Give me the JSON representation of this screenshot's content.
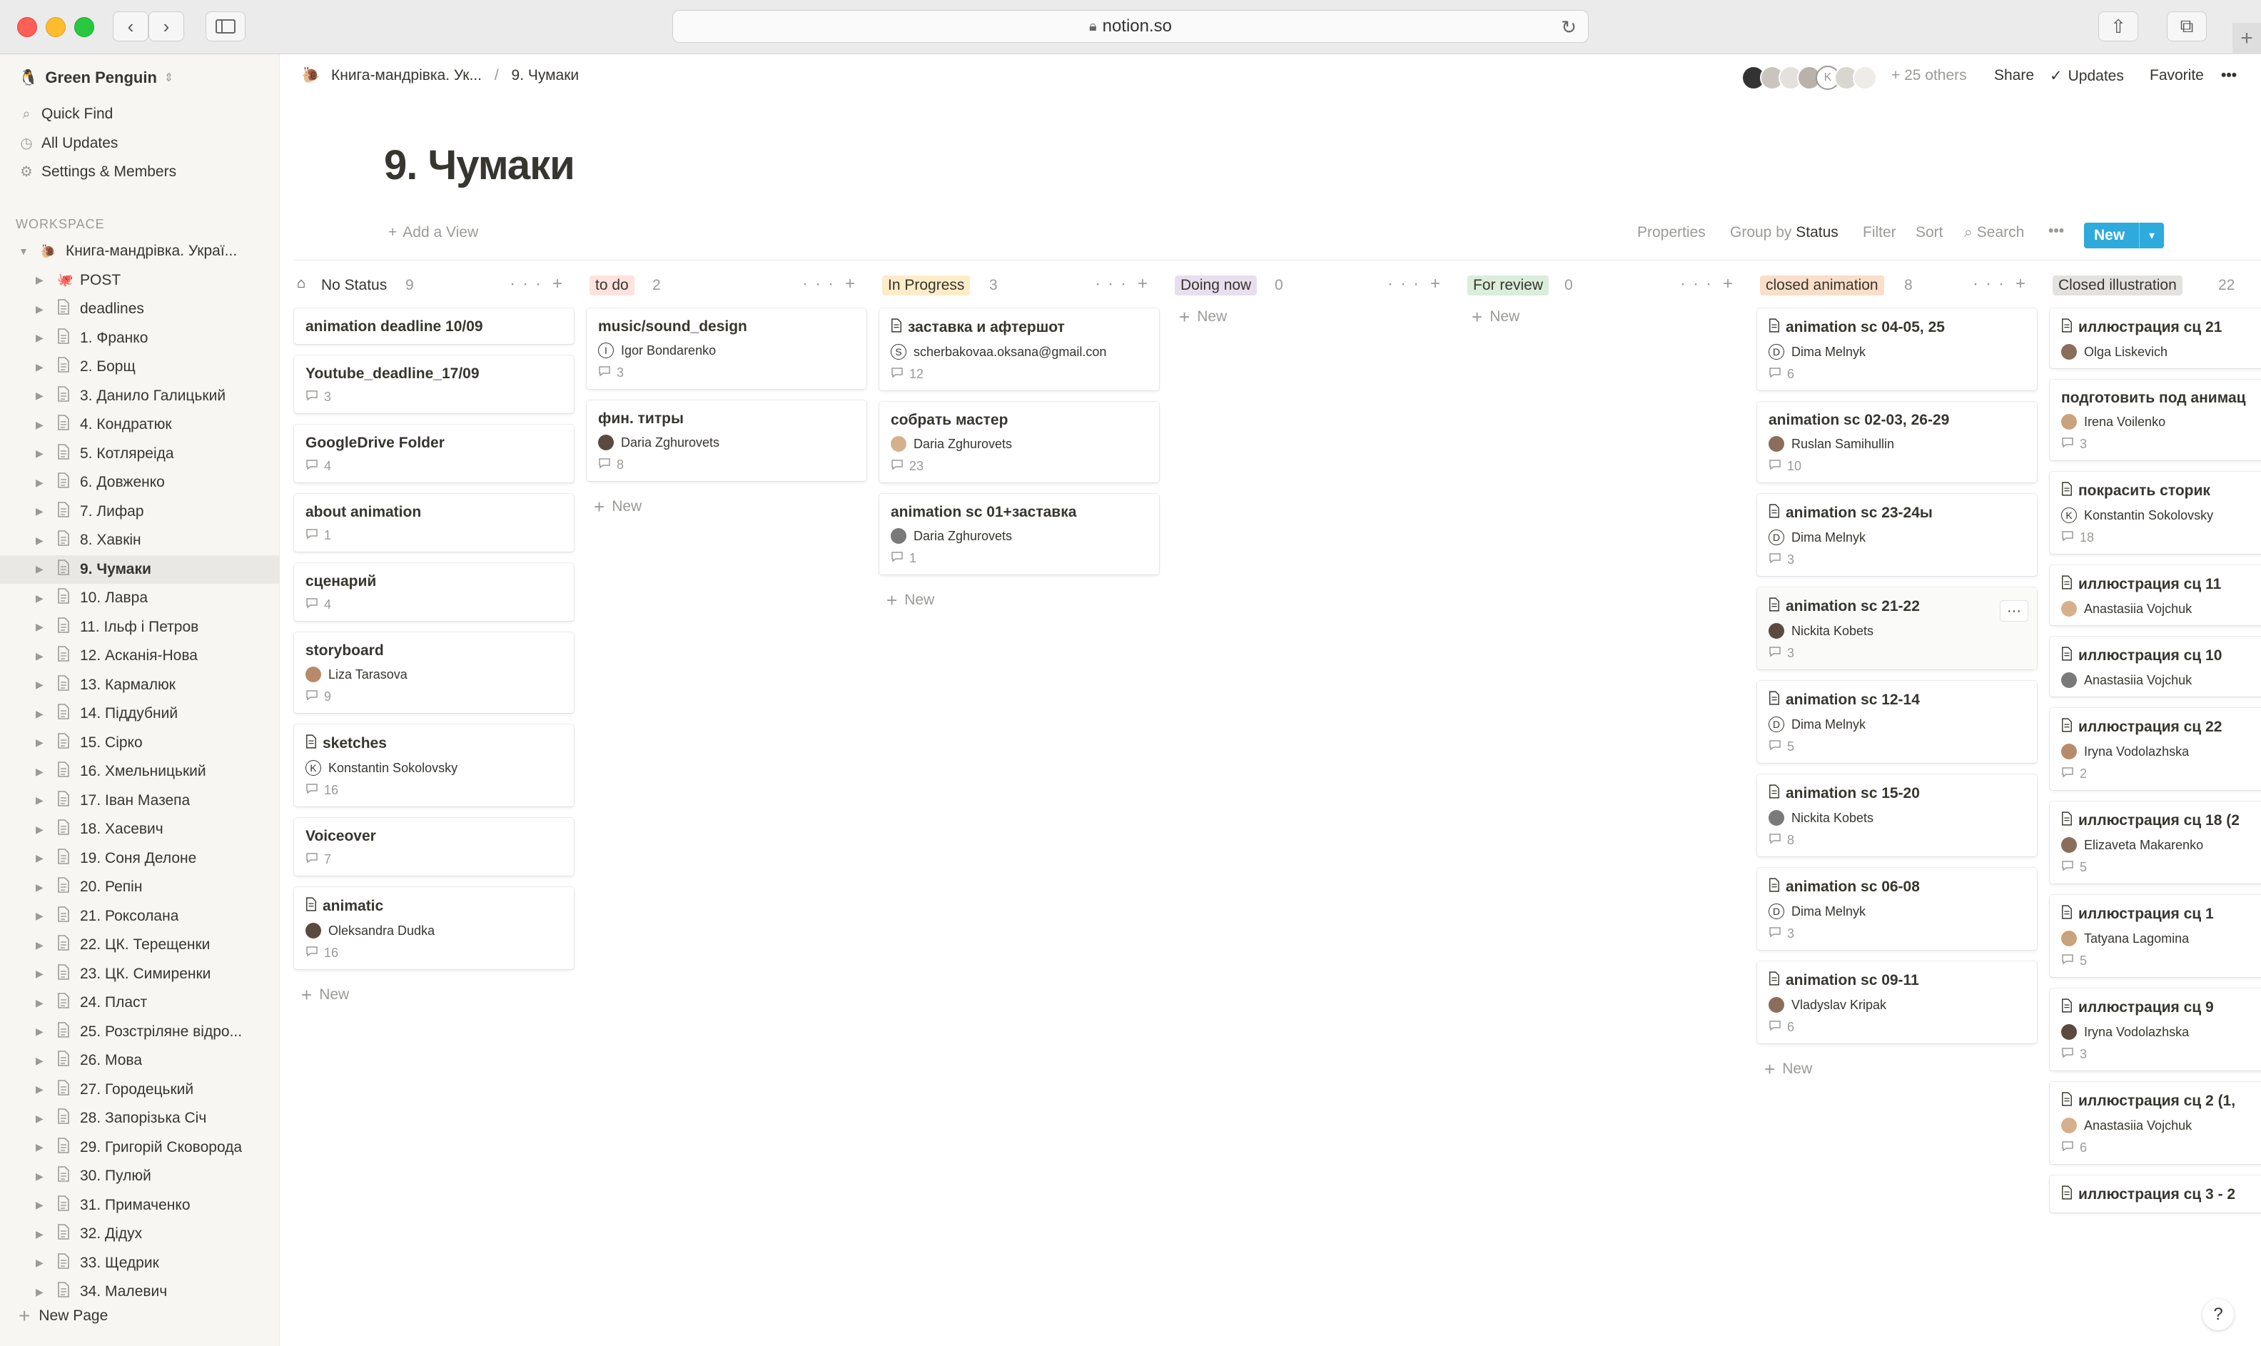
{
  "browser": {
    "url": "notion.so"
  },
  "sidebar": {
    "workspace": "Green Penguin",
    "links": [
      "Quick Find",
      "All Updates",
      "Settings & Members"
    ],
    "section_label": "WORKSPACE",
    "root": "Книга-мандрівка. Украї...",
    "items": [
      "POST",
      "deadlines",
      "1. Франко",
      "2. Борщ",
      "3. Данило Галицький",
      "4. Кондратюк",
      "5. Котляреіда",
      "6. Довженко",
      "7. Лифар",
      "8. Хавкін",
      "9. Чумаки",
      "10. Лавра",
      "11. Ільф і Петров",
      "12. Асканія-Нова",
      "13. Кармалюк",
      "14. Піддубний",
      "15. Сірко",
      "16. Хмельницький",
      "17. Іван Мазепа",
      "18. Хасевич",
      "19. Соня Делоне",
      "20. Репін",
      "21. Роксолана",
      "22. ЦК. Терещенки",
      "23. ЦК. Симиренки",
      "24. Пласт",
      "25. Розстріляне відро...",
      "26. Мова",
      "27. Городецький",
      "28. Запорізька Січ",
      "29. Григорій Сковорода",
      "30. Пулюй",
      "31. Примаченко",
      "32. Дідух",
      "33. Щедрик",
      "34. Малевич"
    ],
    "new_page": "New Page"
  },
  "topbar": {
    "crumb_parent": "Книга-мандрівка. Ук...",
    "crumb_sep": "/",
    "crumb_current": "9. Чумаки",
    "others": "+ 25 others",
    "share": "Share",
    "updates": "Updates",
    "favorite": "Favorite",
    "more": "•••"
  },
  "page": {
    "title": "9. Чумаки"
  },
  "viewbar": {
    "add_view": "Add a View",
    "properties": "Properties",
    "group_by": "Group by",
    "group_value": "Status",
    "filter": "Filter",
    "sort": "Sort",
    "search": "Search",
    "more": "•••",
    "new": "New"
  },
  "colors": {
    "accent": "#2eaadc"
  },
  "new_label": "New",
  "columns": [
    {
      "name": "No Status",
      "count": "9",
      "color": "transparent",
      "cards": [
        {
          "title": "animation deadline 10/09"
        },
        {
          "title": "Youtube_deadline_17/09",
          "comments": "3"
        },
        {
          "title": "GoogleDrive Folder",
          "comments": "4"
        },
        {
          "title": "about animation",
          "comments": "1"
        },
        {
          "title": "сценарий",
          "comments": "4"
        },
        {
          "title": "storyboard",
          "person": "Liza Tarasova",
          "comments": "9"
        },
        {
          "title": "sketches",
          "doc": true,
          "person": "Konstantin Sokolovsky",
          "letter": "K",
          "comments": "16"
        },
        {
          "title": "Voiceover",
          "comments": "7"
        },
        {
          "title": "animatic",
          "doc": true,
          "person": "Oleksandra Dudka",
          "comments": "16"
        }
      ]
    },
    {
      "name": "to do",
      "count": "2",
      "color": "#ffe2dd",
      "cards": [
        {
          "title": "music/sound_design",
          "person": "Igor Bondarenko",
          "letter": "I",
          "comments": "3"
        },
        {
          "title": "фин. титры",
          "person": "Daria Zghurovets",
          "comments": "8"
        }
      ]
    },
    {
      "name": "In Progress",
      "count": "3",
      "color": "#fdecc8",
      "cards": [
        {
          "title": "заставка и афтершот",
          "doc": true,
          "person": "scherbakovaa.oksana@gmail.con",
          "letter": "S",
          "comments": "12"
        },
        {
          "title": "собрать мастер",
          "person": "Daria Zghurovets",
          "comments": "23"
        },
        {
          "title": "animation sc 01+заставка",
          "person": "Daria Zghurovets",
          "comments": "1"
        }
      ]
    },
    {
      "name": "Doing now",
      "count": "0",
      "color": "#e8deee",
      "cards": []
    },
    {
      "name": "For review",
      "count": "0",
      "color": "#dbeddb",
      "cards": []
    },
    {
      "name": "closed animation",
      "count": "8",
      "color": "#fadec9",
      "cards": [
        {
          "title": "animation sc 04-05, 25",
          "doc": true,
          "person": "Dima Melnyk",
          "letter": "D",
          "comments": "6"
        },
        {
          "title": "animation sc 02-03, 26-29",
          "person": "Ruslan Samihullin",
          "comments": "10"
        },
        {
          "title": "animation sc 23-24ы",
          "doc": true,
          "person": "Dima Melnyk",
          "letter": "D",
          "comments": "3"
        },
        {
          "title": "animation sc 21-22",
          "doc": true,
          "person": "Nickita Kobets",
          "comments": "3",
          "hover": true
        },
        {
          "title": "animation sc 12-14",
          "doc": true,
          "person": "Dima Melnyk",
          "letter": "D",
          "comments": "5"
        },
        {
          "title": "animation sc 15-20",
          "doc": true,
          "person": "Nickita Kobets",
          "comments": "8"
        },
        {
          "title": "animation sc 06-08",
          "doc": true,
          "person": "Dima Melnyk",
          "letter": "D",
          "comments": "3"
        },
        {
          "title": "animation sc 09-11",
          "doc": true,
          "person": "Vladyslav Kripak",
          "comments": "6"
        }
      ]
    },
    {
      "name": "Closed illustration",
      "count": "22",
      "color": "#e3e2e0",
      "cards": [
        {
          "title": "иллюстрация сц 21",
          "doc": true,
          "person": "Olga Liskevich"
        },
        {
          "title": "подготовить под анимац",
          "person": "Irena Voilenko",
          "comments": "3"
        },
        {
          "title": "покрасить сторик",
          "doc": true,
          "person": "Konstantin Sokolovsky",
          "letter": "K",
          "comments": "18"
        },
        {
          "title": "иллюстрация сц 11",
          "doc": true,
          "person": "Anastasiia Vojchuk"
        },
        {
          "title": "иллюстрация сц 10",
          "doc": true,
          "person": "Anastasiia Vojchuk"
        },
        {
          "title": "иллюстрация сц 22",
          "doc": true,
          "person": "Iryna Vodolazhska",
          "comments": "2"
        },
        {
          "title": "иллюстрация сц 18 (2",
          "doc": true,
          "person": "Elizaveta Makarenko",
          "comments": "5"
        },
        {
          "title": "иллюстрация сц 1",
          "doc": true,
          "person": "Tatyana Lagomina",
          "comments": "5"
        },
        {
          "title": "иллюстрация сц 9",
          "doc": true,
          "person": "Iryna Vodolazhska",
          "comments": "3"
        },
        {
          "title": "иллюстрация сц 2 (1,",
          "doc": true,
          "person": "Anastasiia Vojchuk",
          "comments": "6"
        },
        {
          "title": "иллюстрация сц 3 - 2",
          "doc": true
        }
      ]
    }
  ]
}
